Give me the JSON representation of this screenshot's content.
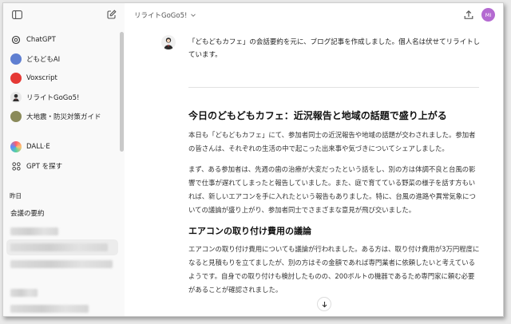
{
  "sidebar": {
    "items": [
      {
        "label": "ChatGPT",
        "icon": "chatgpt-icon"
      },
      {
        "label": "どもどもAI",
        "icon": "gpt-avatar-icon"
      },
      {
        "label": "Voxscript",
        "icon": "voxscript-icon"
      },
      {
        "label": "リライトGoGo5!",
        "icon": "gpt-avatar-icon"
      },
      {
        "label": "大地震・防災対策ガイド",
        "icon": "gpt-avatar-icon"
      }
    ],
    "dalle_label": "DALL·E",
    "explore_label": "GPT を探す",
    "section_yesterday": "昨日",
    "history": [
      "会議の要約"
    ]
  },
  "header": {
    "model_name": "リライトGoGo5!",
    "user_initials": "MI"
  },
  "conversation": {
    "prompt": "「どもどもカフェ」の会話要約を元に、ブログ記事を作成しました。個人名は伏せてリライトしています。",
    "article": {
      "title": "今日のどもどもカフェ：近況報告と地域の話題で盛り上がる",
      "p1": "本日も「どもどもカフェ」にて、参加者同士の近況報告や地域の話題が交わされました。参加者の皆さんは、それぞれの生活の中で起こった出来事や気づきについてシェアしました。",
      "p2": "まず、ある参加者は、先週の歯の治療が大変だったという話をし、別の方は体調不良と台風の影響で仕事が遅れてしまったと報告していました。また、庭で育てている野菜の様子を話す方もいれば、新しいエアコンを手に入れたという報告もありました。特に、台風の進路や異常気象についての議論が盛り上がり、参加者同士でさまざまな意見が飛び交いました。",
      "subtitle": "エアコンの取り付け費用の議論",
      "p3": "エアコンの取り付け費用についても議論が行われました。ある方は、取り付け費用が3万円程度になると見積もりを立てましたが、別の方はその金額であれば専門業者に依頼したいと考えているようです。自身での取り付けも検討したものの、200ボルトの機器であるため専門家に頼む必要があることが確認されました。"
    }
  },
  "colors": {
    "avatar_bg": "#b46ad1",
    "voxscript_red": "#e53935"
  }
}
